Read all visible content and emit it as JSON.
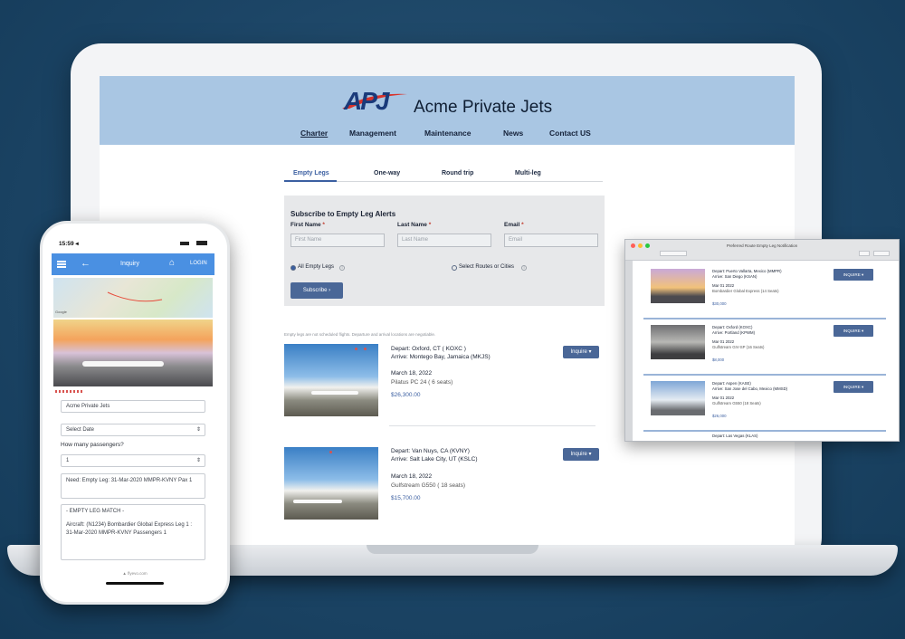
{
  "site": {
    "brand": "Acme Private Jets",
    "logo_text": "APJ",
    "nav": [
      "Charter",
      "Management",
      "Maintenance",
      "News",
      "Contact US"
    ]
  },
  "tabs": [
    "Empty Legs",
    "One-way",
    "Round trip",
    "Multi-leg"
  ],
  "subscribe": {
    "title": "Subscribe to Empty Leg Alerts",
    "first_label": "First Name",
    "last_label": "Last Name",
    "email_label": "Email",
    "required_mark": "*",
    "first_placeholder": "First Name",
    "last_placeholder": "Last Name",
    "email_placeholder": "Email",
    "option_all": "All Empty Legs",
    "option_select": "Select Routes or Cities",
    "info_glyph": "i",
    "button": "Subscribe ›"
  },
  "disclaimer": "Empty legs are not scheduled flights. Departure and arrival locations are negotiable.",
  "flights": [
    {
      "depart": "Depart:  Oxford, CT ( KOXC )",
      "arrive": "Arrive:  Montego Bay, Jamaica (MKJS)",
      "date": "March 18, 2022",
      "aircraft": "Pilatus PC 24 ( 6 seats)",
      "price": "$26,300.00",
      "button": "Inquire ▾"
    },
    {
      "depart": "Depart:  Van Nuys, CA (KVNY)",
      "arrive": "Arrive:  Salt Lake City, UT (KSLC)",
      "date": "March 18, 2022",
      "aircraft": "Gulfstream G550 ( 18 seats)",
      "price": "$15,700.00",
      "button": "Inquire ▾"
    }
  ],
  "notification": {
    "title": "Preferred Route Empty Leg Notification",
    "items": [
      {
        "depart": "Depart: Puerto Vallarta, Mexico (MMPR)",
        "arrive": "Arrive: San Diego (KSAN)",
        "date": "Mar 01 2022",
        "aircraft": "Bombardier Global Express (14 Seats)",
        "price": "$30,000",
        "button": "INQUIRE ▾"
      },
      {
        "depart": "Depart: Oxford (KOXC)",
        "arrive": "Arrive: Portland (KPWM)",
        "date": "Mar 01 2022",
        "aircraft": "Gulfstream GIV-SP (16 Seats)",
        "price": "$8,000",
        "button": "INQUIRE ▾"
      },
      {
        "depart": "Depart: Aspen (KASE)",
        "arrive": "Arrive: San Jose del Cabo, Mexico (MMSD)",
        "date": "Mar 01 2022",
        "aircraft": "Gulfstream G550 (18 Seats)",
        "price": "$26,000",
        "button": "INQUIRE ▾"
      },
      {
        "depart": "Depart: Las Vegas (KLAS)"
      }
    ]
  },
  "phone": {
    "time": "15:59 ◂",
    "screen_title": "Inquiry",
    "login": "LOGIN",
    "map_attribution": "Google",
    "operator": "Acme Private Jets",
    "select_date": "Select Date",
    "passengers_label": "How many passengers?",
    "passengers_value": "1",
    "need_text": "Need: Empty Leg: 31-Mar-2020 MMPR-KVNY Pax 1",
    "match_title": "- EMPTY LEG MATCH -",
    "match_text": "Aircraft: (N1234) Bombardier Global Express Leg 1 : 31-Mar-2020 MMPR-KVNY Passengers 1",
    "footer": "▲ flyevo.com"
  },
  "colors": {
    "header": "#a9c6e3",
    "accent": "#3b5fa1",
    "button": "#4a6797",
    "logo_red": "#d9322a",
    "logo_navy": "#1a3a7a",
    "phone_bar": "#4a90e2"
  }
}
